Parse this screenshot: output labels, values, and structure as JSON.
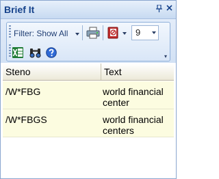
{
  "panel": {
    "title": "Brief It",
    "pin_glyph": "ₕ",
    "close_glyph": "✕"
  },
  "toolbar": {
    "filter_label": "Filter: Show All",
    "print_icon": "printer-icon",
    "dictionary_icon": "dictionary-icon",
    "count_value": "9",
    "excel_icon": "excel-icon",
    "binoculars_icon": "binoculars-icon",
    "help_icon": "help-icon"
  },
  "grid": {
    "columns": [
      "Steno",
      "Text"
    ],
    "rows": [
      {
        "steno": "/W*FBG",
        "text": "world financial center"
      },
      {
        "steno": "/W*FBGS",
        "text": "world financial centers"
      }
    ]
  },
  "colors": {
    "title": "#15428b",
    "row_bg": "#fcfce0",
    "toolbar_border": "#8fb0da"
  }
}
